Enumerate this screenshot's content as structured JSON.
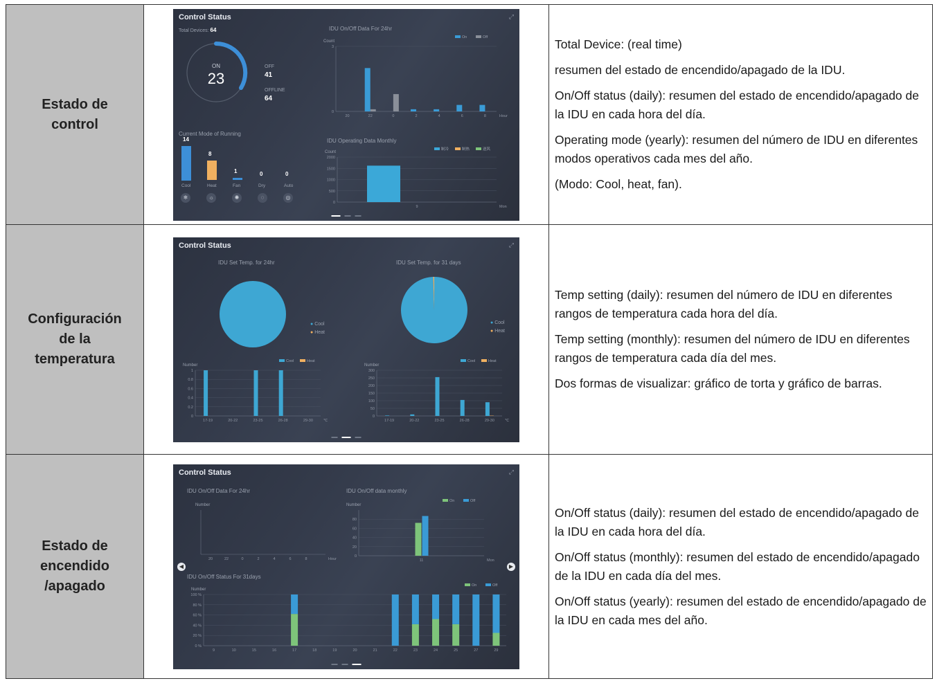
{
  "colors": {
    "cool": "#3d9be0",
    "heat": "#f0b060",
    "green": "#7ec47a",
    "blue": "#3a9bd6",
    "pie": "#3ea7d3",
    "off": "#8a8f99"
  },
  "rows": [
    {
      "label": "Estado de control",
      "screen": {
        "title": "Control Status",
        "total_label": "Total Devices:",
        "total_value": "64",
        "on_label": "ON",
        "on_value": "23",
        "off_label": "OFF",
        "off_value": "41",
        "offline_label": "OFFLINE",
        "offline_value": "64",
        "onoff_title": "IDU On/Off Data For 24hr",
        "onoff_ylabel": "Count",
        "onoff_legend": [
          "On",
          "Off"
        ],
        "onoff_xunit": "Hour",
        "mode_title": "Current Mode of Running",
        "modes": [
          {
            "name": "Cool",
            "value": "14",
            "icon": "snowflake-icon",
            "glyph": "❄"
          },
          {
            "name": "Heat",
            "value": "8",
            "icon": "sun-icon",
            "glyph": "☼"
          },
          {
            "name": "Fan",
            "value": "1",
            "icon": "fan-icon",
            "glyph": "✺"
          },
          {
            "name": "Dry",
            "value": "0",
            "icon": "drop-icon",
            "glyph": "◌"
          },
          {
            "name": "Auto",
            "value": "0",
            "icon": "auto-icon",
            "glyph": "◎"
          }
        ],
        "monthly_title": "IDU Operating Data Monthly",
        "monthly_ylabel": "Count",
        "monthly_legend": [
          "制冷",
          "制热",
          "送风"
        ],
        "monthly_xunit": "Mon"
      },
      "desc": [
        "Total Device: (real time)",
        "resumen del estado de encendido/apagado de la IDU.",
        "On/Off status (daily): resumen del estado de encendido/apagado de la IDU en cada hora del día.",
        "Operating mode (yearly): resumen del número de IDU en diferentes modos operativos cada mes del año.",
        "(Modo: Cool, heat, fan)."
      ]
    },
    {
      "label": "Configuración de la temperatura",
      "screen": {
        "title": "Control Status",
        "pie1_title": "IDU Set Temp. for 24hr",
        "pie2_title": "IDU Set Temp. for 31 days",
        "pie_legend": [
          "Cool",
          "Heat"
        ],
        "bar_ylabel": "Number",
        "bar_legend": [
          "Cool",
          "Heat"
        ],
        "bar_xunit": "℃"
      },
      "desc": [
        "Temp setting (daily): resumen del número de IDU en diferentes rangos de temperatura cada hora del día.",
        "Temp setting (monthly): resumen del número de IDU en diferentes rangos de temperatura cada día del mes.",
        "Dos formas de visualizar: gráfico de torta y gráfico de barras."
      ]
    },
    {
      "label": "Estado de encendido /apagado",
      "screen": {
        "title": "Control Status",
        "daily_title": "IDU On/Off Data For 24hr",
        "daily_ylabel": "Number",
        "daily_xunit": "Hour",
        "monthly_title": "IDU On/Off data monthly",
        "monthly_ylabel": "Number",
        "monthly_legend": [
          "On",
          "Off"
        ],
        "monthly_xunit": "Mon",
        "status_title": "IDU On/Off Status For 31days",
        "status_ylabel": "Number",
        "status_legend": [
          "On",
          "Off"
        ]
      },
      "desc": [
        "On/Off status (daily): resumen del estado de encendido/apagado de la IDU en cada hora del día.",
        "On/Off status (monthly): resumen del estado de encendido/apagado de la IDU en cada día del mes.",
        "On/Off status (yearly): resumen del estado de encendido/apagado de la IDU en cada mes del año."
      ]
    }
  ],
  "chart_data": [
    {
      "type": "bar",
      "title": "IDU On/Off Data For 24hr",
      "ylabel": "Count",
      "xlabel": "Hour",
      "categories": [
        "20",
        "22",
        "0",
        "2",
        "4",
        "6",
        "8"
      ],
      "ylim": [
        0,
        3
      ],
      "series": [
        {
          "name": "On",
          "values": [
            0,
            2,
            0,
            0.1,
            0.1,
            0.3,
            0.3
          ]
        },
        {
          "name": "Off",
          "values": [
            0,
            0.1,
            0.8,
            0,
            0,
            0,
            0
          ]
        }
      ]
    },
    {
      "type": "bar",
      "title": "IDU Operating Data Monthly",
      "ylabel": "Count",
      "xlabel": "Mon",
      "categories": [
        "9"
      ],
      "ylim": [
        0,
        2000
      ],
      "series": [
        {
          "name": "制冷",
          "values": [
            1620
          ]
        },
        {
          "name": "制热",
          "values": [
            0
          ]
        },
        {
          "name": "送风",
          "values": [
            0
          ]
        }
      ]
    },
    {
      "type": "pie",
      "title": "IDU Set Temp. for 24hr",
      "categories": [
        "Cool",
        "Heat"
      ],
      "values": [
        100,
        0
      ]
    },
    {
      "type": "pie",
      "title": "IDU Set Temp. for 31 days",
      "categories": [
        "Cool",
        "Heat"
      ],
      "values": [
        99.5,
        0.5
      ]
    },
    {
      "type": "bar",
      "ylabel": "Number",
      "xlabel": "℃",
      "categories": [
        "17-19",
        "20-22",
        "23-25",
        "26-28",
        "29-30"
      ],
      "ylim": [
        0,
        1
      ],
      "series": [
        {
          "name": "Cool",
          "values": [
            1,
            0,
            1,
            1,
            0
          ]
        },
        {
          "name": "Heat",
          "values": [
            0,
            0,
            0,
            0,
            0
          ]
        }
      ]
    },
    {
      "type": "bar",
      "ylabel": "Number",
      "xlabel": "℃",
      "categories": [
        "17-19",
        "20-22",
        "23-25",
        "26-28",
        "29-30"
      ],
      "ylim": [
        0,
        300
      ],
      "series": [
        {
          "name": "Cool",
          "values": [
            3,
            10,
            255,
            105,
            90
          ]
        },
        {
          "name": "Heat",
          "values": [
            0,
            0,
            0,
            0,
            2
          ]
        }
      ]
    },
    {
      "type": "bar",
      "title": "IDU On/Off data monthly",
      "ylabel": "Number",
      "xlabel": "Mon",
      "categories": [
        "11"
      ],
      "ylim": [
        0,
        100
      ],
      "series": [
        {
          "name": "On",
          "values": [
            72
          ]
        },
        {
          "name": "Off",
          "values": [
            87
          ]
        }
      ]
    },
    {
      "type": "bar",
      "title": "IDU On/Off Status For 31days",
      "ylabel": "Number",
      "categories": [
        "9",
        "10",
        "15",
        "16",
        "17",
        "18",
        "19",
        "20",
        "21",
        "22",
        "23",
        "24",
        "25",
        "27",
        "29"
      ],
      "ylim": [
        0,
        100
      ],
      "series": [
        {
          "name": "On",
          "values": [
            0,
            0,
            0,
            0,
            62,
            0,
            0,
            0,
            0,
            0,
            42,
            52,
            42,
            0,
            25
          ]
        },
        {
          "name": "Off",
          "values": [
            0,
            0,
            0,
            0,
            38,
            0,
            0,
            0,
            0,
            100,
            58,
            48,
            58,
            100,
            75
          ]
        }
      ]
    }
  ]
}
